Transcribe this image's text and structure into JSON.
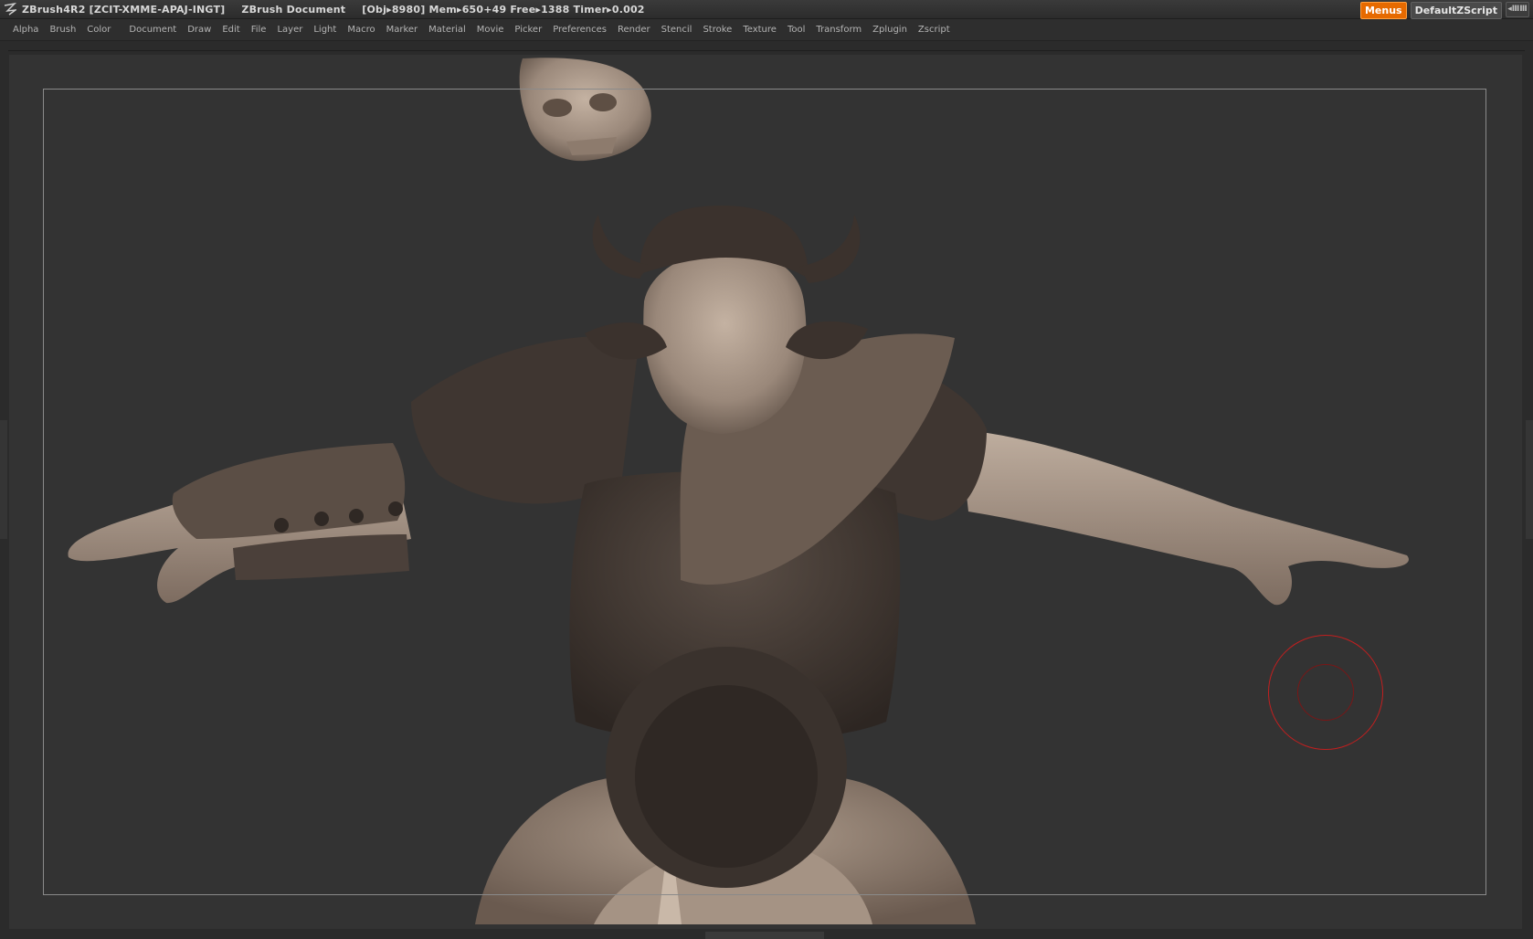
{
  "titlebar": {
    "app": "ZBrush4R2 [ZCIT-XMME-APAJ-INGT]",
    "document": "ZBrush Document",
    "stats": "[Obj▸8980] Mem▸650+49 Free▸1388 Timer▸0.002",
    "menus_button": "Menus",
    "script_button": "DefaultZScript",
    "mini_button": "◂ⅢⅢ"
  },
  "menubar": {
    "items": [
      "Alpha",
      "Brush",
      "Color",
      "Document",
      "Draw",
      "Edit",
      "File",
      "Layer",
      "Light",
      "Macro",
      "Marker",
      "Material",
      "Movie",
      "Picker",
      "Preferences",
      "Render",
      "Stencil",
      "Stroke",
      "Texture",
      "Tool",
      "Transform",
      "Zplugin",
      "Zscript"
    ]
  },
  "colors": {
    "accent": "#e66a00",
    "canvas": "#333333",
    "clay": "#a89686",
    "clay_dark": "#3d3530",
    "brush_ring": "#c21f1f"
  },
  "icons": {
    "logo": "zbrush-logo-icon"
  }
}
